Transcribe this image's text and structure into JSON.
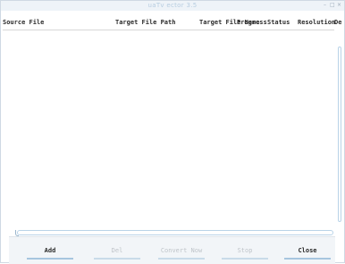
{
  "window": {
    "title": "uaTv ector 3.5",
    "controls": [
      "–",
      "□",
      "×"
    ]
  },
  "table": {
    "columns": [
      "Source File",
      "Target File Path",
      "Target File Name",
      "Progress",
      "Status",
      "Resolution",
      "De"
    ],
    "rows": []
  },
  "buttons": {
    "add": "Add",
    "del": "Del",
    "convert_now": "Convert Now",
    "stop": "Stop",
    "close": "Close"
  }
}
